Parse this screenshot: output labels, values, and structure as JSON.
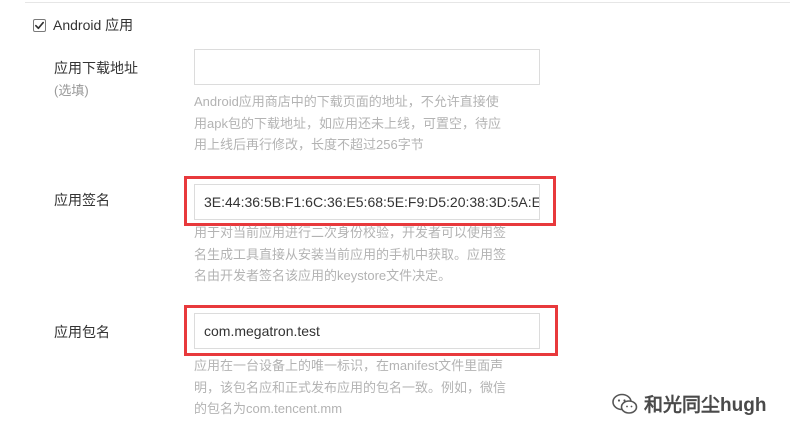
{
  "android_section": {
    "checkbox_label": "Android 应用",
    "checked": true
  },
  "download_url": {
    "label": "应用下载地址",
    "optional": "(选填)",
    "value": "",
    "hint_lines": [
      "Android应用商店中的下载页面的地址，不允许直接使",
      "用apk包的下载地址，如应用还未上线，可置空，待应",
      "用上线后再行修改，长度不超过256字节"
    ]
  },
  "signature": {
    "label": "应用签名",
    "value": "3E:44:36:5B:F1:6C:36:E5:68:5E:F9:D5:20:38:3D:5A:E",
    "hint_lines": [
      "用于对当前应用进行二次身份校验，开发者可以使用签",
      "名生成工具直接从安装当前应用的手机中获取。应用签",
      "名由开发者签名该应用的keystore文件决定。"
    ]
  },
  "package_name": {
    "label": "应用包名",
    "value": "com.megatron.test",
    "hint_lines": [
      "应用在一台设备上的唯一标识，在manifest文件里面声",
      "明，该包名应和正式发布应用的包名一致。例如，微信",
      "的包名为com.tencent.mm"
    ]
  },
  "watermark": {
    "text": "和光同尘hugh",
    "icon": "wechat-icon"
  },
  "colors": {
    "highlight": "#e8393c",
    "hint_text": "#b3b3b3",
    "input_border": "#dcdcdc"
  }
}
